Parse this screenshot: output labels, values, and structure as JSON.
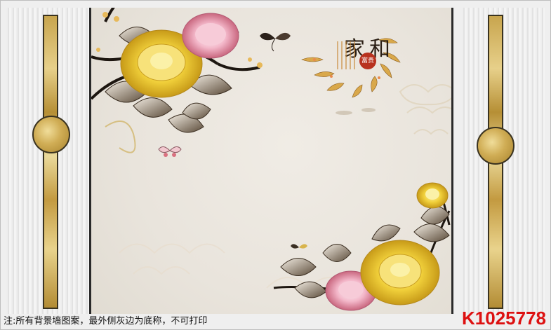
{
  "mural": {
    "title_main": "家和",
    "title_badge": "富贵"
  },
  "footer": {
    "note": "注:所有背景墙图案，最外侧灰边为底称，不可打印",
    "code": "K1025778"
  },
  "colors": {
    "background": "#e9e4dc",
    "gold": "#d0ad55",
    "code_red": "#dd1111"
  }
}
